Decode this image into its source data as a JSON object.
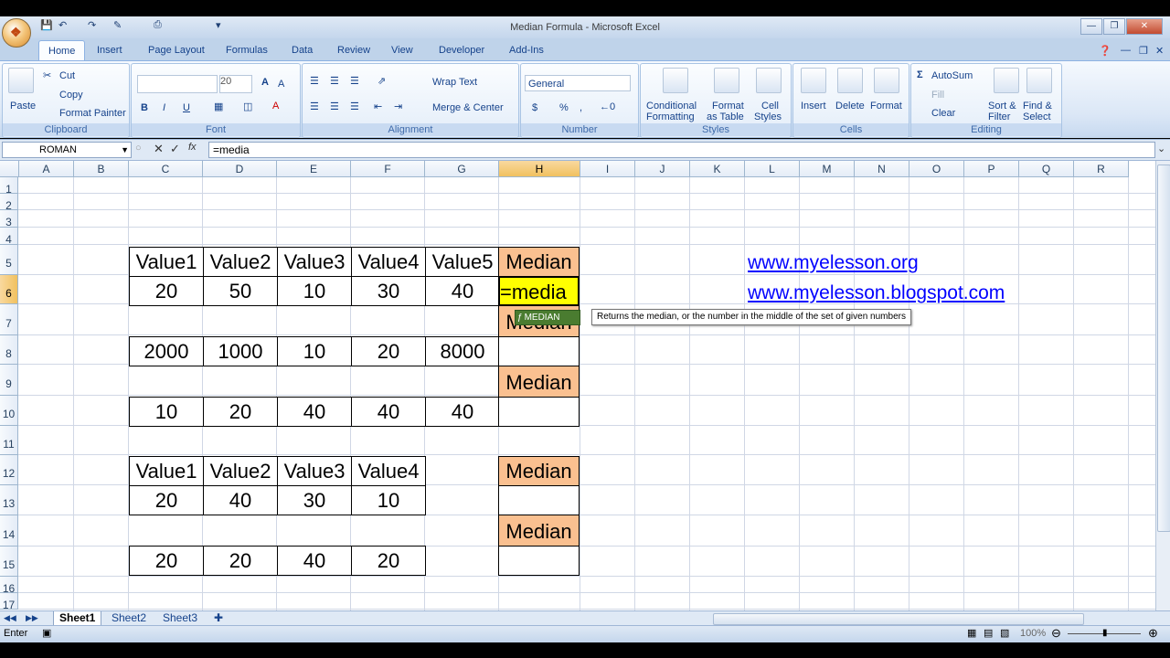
{
  "window": {
    "title": "Median Formula - Microsoft Excel"
  },
  "tabs": [
    "Home",
    "Insert",
    "Page Layout",
    "Formulas",
    "Data",
    "Review",
    "View",
    "Developer",
    "Add-Ins"
  ],
  "ribbon": {
    "clipboard": {
      "paste": "Paste",
      "cut": "Cut",
      "copy": "Copy",
      "format_painter": "Format Painter",
      "label": "Clipboard"
    },
    "font": {
      "size": "20",
      "bold": "B",
      "italic": "I",
      "underline": "U",
      "label": "Font"
    },
    "alignment": {
      "wrap": "Wrap Text",
      "merge": "Merge & Center",
      "label": "Alignment"
    },
    "number": {
      "format": "General",
      "currency": "$",
      "percent": "%",
      "comma": ",",
      "label": "Number"
    },
    "styles": {
      "conditional": "Conditional",
      "conditional2": "Formatting",
      "format_table": "Format",
      "format_table2": "as Table",
      "cell_styles": "Cell",
      "cell_styles2": "Styles",
      "label": "Styles"
    },
    "cells": {
      "insert": "Insert",
      "delete": "Delete",
      "format": "Format",
      "label": "Cells"
    },
    "editing": {
      "autosum": "AutoSum",
      "fill": "Fill",
      "clear": "Clear",
      "sort": "Sort &",
      "sort2": "Filter",
      "find": "Find &",
      "find2": "Select",
      "label": "Editing"
    }
  },
  "formula_bar": {
    "name_box": "ROMAN",
    "formula": "=media"
  },
  "columns": [
    "A",
    "B",
    "C",
    "D",
    "E",
    "F",
    "G",
    "H",
    "I",
    "J",
    "K",
    "L",
    "M",
    "N",
    "O",
    "P",
    "Q",
    "R"
  ],
  "rows": [
    "1",
    "2",
    "3",
    "4",
    "5",
    "6",
    "7",
    "8",
    "9",
    "10",
    "11",
    "12",
    "13",
    "14",
    "15",
    "16",
    "17"
  ],
  "table1": {
    "headers": [
      "Value1",
      "Value2",
      "Value3",
      "Value4",
      "Value5",
      "Median"
    ],
    "row6": [
      "20",
      "50",
      "10",
      "30",
      "40",
      "=media"
    ],
    "h7": "Median",
    "row8": [
      "2000",
      "1000",
      "10",
      "20",
      "8000"
    ],
    "h9": "Median",
    "row10": [
      "10",
      "20",
      "40",
      "40",
      "40"
    ]
  },
  "table2": {
    "headers": [
      "Value1",
      "Value2",
      "Value3",
      "Value4",
      "Median"
    ],
    "row13": [
      "20",
      "40",
      "30",
      "10"
    ],
    "h14": "Median",
    "row15": [
      "20",
      "20",
      "40",
      "20"
    ]
  },
  "links": [
    "www.myelesson.org",
    "www.myelesson.blogspot.com"
  ],
  "autocomplete": {
    "item": "MEDIAN",
    "tooltip": "Returns the median, or the number in the middle of the set of given numbers"
  },
  "sheets": [
    "Sheet1",
    "Sheet2",
    "Sheet3"
  ],
  "status": {
    "mode": "Enter",
    "zoom": "100%"
  }
}
